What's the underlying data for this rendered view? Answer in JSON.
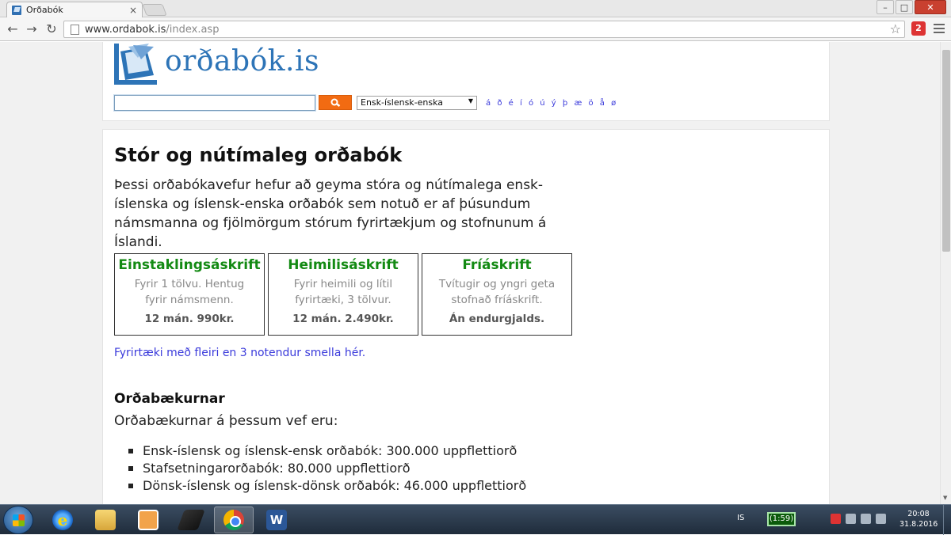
{
  "browser": {
    "tab_title": "Orðabók",
    "tab_close": "×",
    "url_host": "www.ordabok.is",
    "url_path": "/index.asp",
    "ext_badge": "2",
    "window_controls": {
      "minimize": "–",
      "maximize": "□",
      "close": "✕"
    }
  },
  "header": {
    "logo_text": "orðabók.is",
    "search": {
      "value": "",
      "placeholder": ""
    },
    "dictionary_select": "Ensk-íslensk-enska",
    "special_chars": [
      "á",
      "ð",
      "é",
      "í",
      "ó",
      "ú",
      "ý",
      "þ",
      "æ",
      "ö",
      "å",
      "ø"
    ]
  },
  "main": {
    "heading": "Stór og nútímaleg orðabók",
    "intro": "Þessi orðabókavefur hefur að geyma stóra og nútímalega ensk-íslenska og íslensk-enska orðabók sem notuð er af þúsundum námsmanna og fjölmörgum stórum fyrirtækjum og stofnunum á Íslandi.",
    "plans": [
      {
        "title": "Einstaklingsáskrift",
        "desc": "Fyrir 1 tölvu. Hentug fyrir námsmenn.",
        "price": "12 mán. 990kr."
      },
      {
        "title": "Heimilisáskrift",
        "desc": "Fyrir heimili og lítil fyrirtæki, 3 tölvur.",
        "price": "12 mán. 2.490kr."
      },
      {
        "title": "Fríáskrift",
        "desc": "Tvítugir og yngri geta stofnað fríáskrift.",
        "price": "Án endurgjalds."
      }
    ],
    "company_link": "Fyrirtæki með fleiri en 3 notendur smella hér.",
    "sub_heading": "Orðabækurnar",
    "sub_intro": "Orðabækurnar á þessum vef eru:",
    "dictionaries": [
      "Ensk-íslensk og íslensk-ensk orðabók: 300.000 uppflettiorð",
      "Stafsetningarorðabók: 80.000 uppflettiorð",
      "Dönsk-íslensk og íslensk-dönsk orðabók: 46.000 uppflettiorð"
    ]
  },
  "taskbar": {
    "word_label": "W",
    "ie_label": "e",
    "language": "IS",
    "battery_time": "(1:59)",
    "clock_time": "20:08",
    "clock_date": "31.8.2016"
  },
  "colors": {
    "brand_blue": "#2d74b7",
    "search_orange": "#f26b12",
    "plan_green": "#138a13",
    "link_blue": "#3a3adb"
  }
}
